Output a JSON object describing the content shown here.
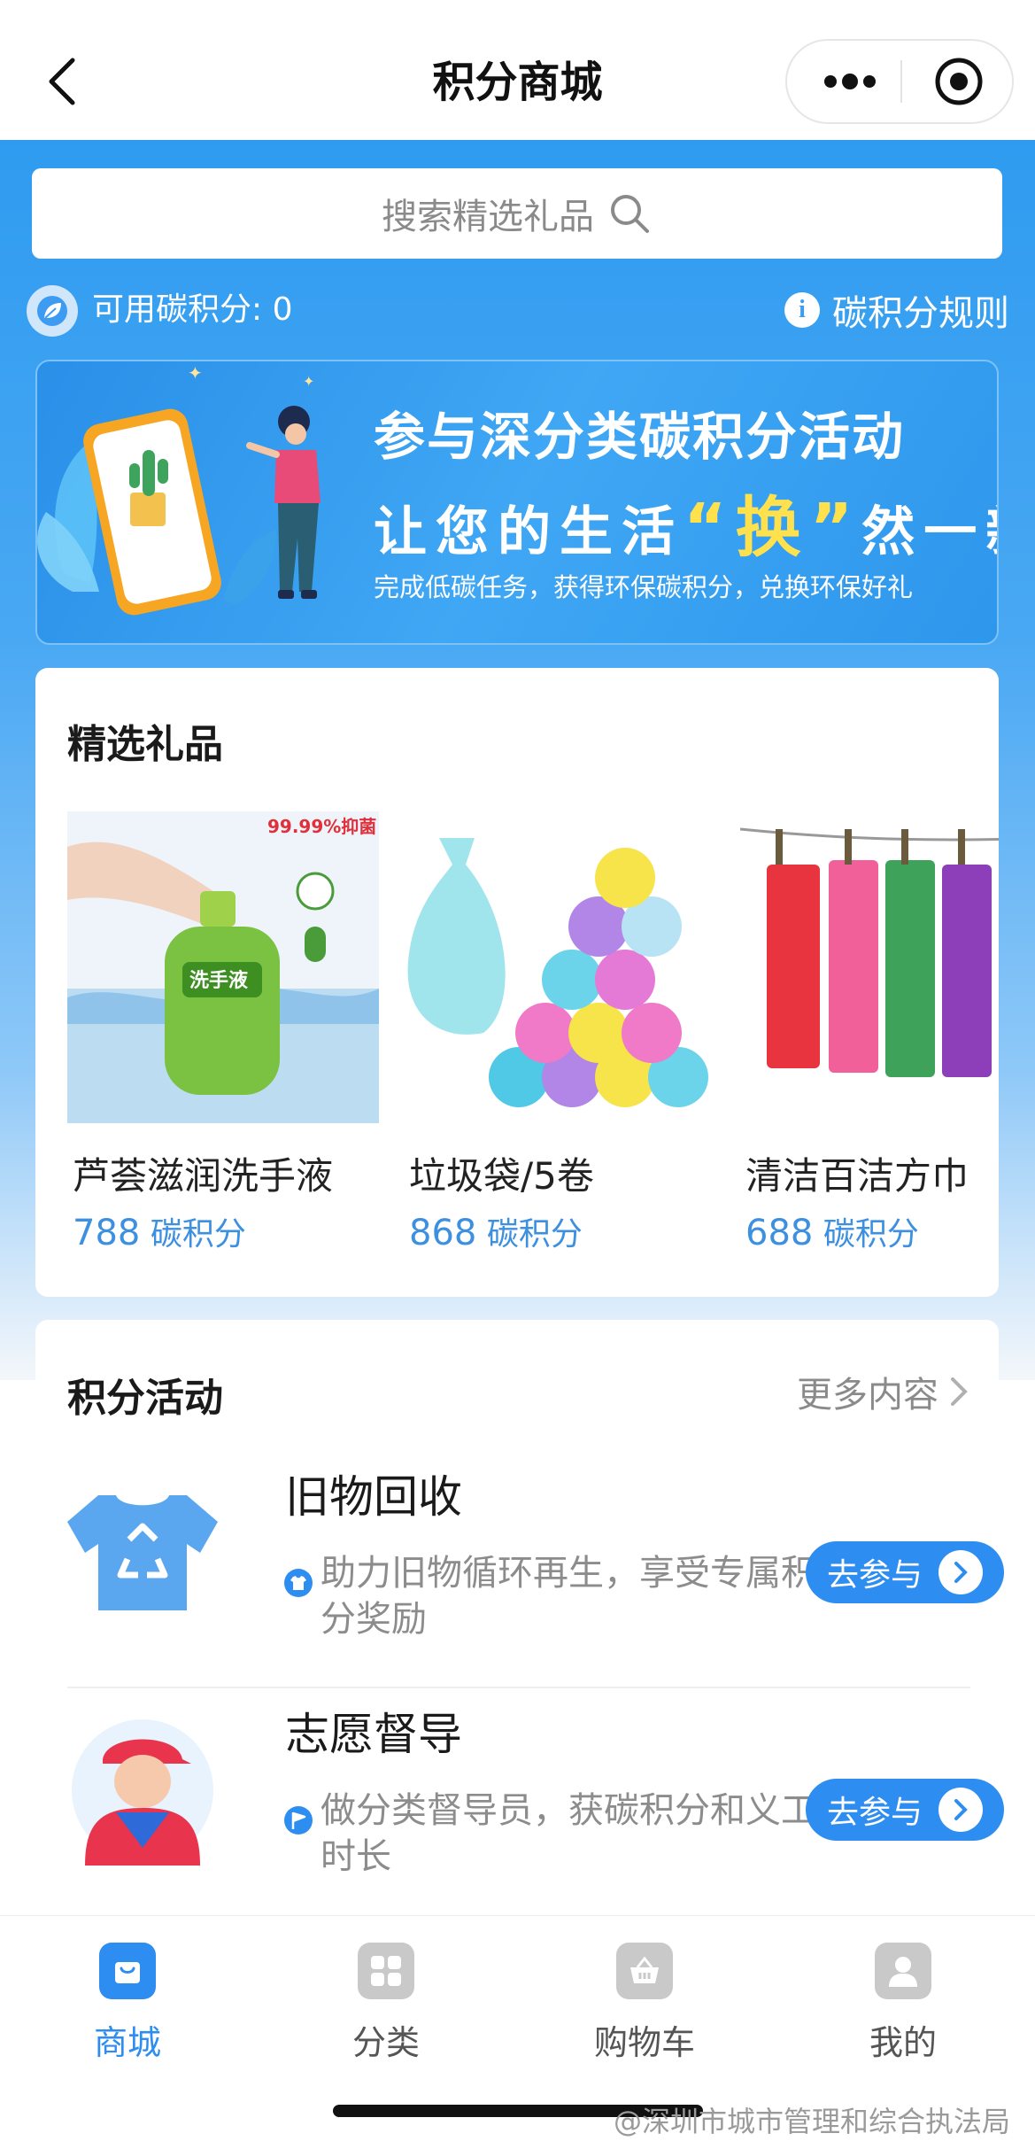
{
  "header": {
    "title": "积分商城",
    "back_icon": "chevron-left-icon",
    "more_icon": "more-dots-icon",
    "close_icon": "target-close-icon"
  },
  "search": {
    "placeholder": "搜索精选礼品"
  },
  "points": {
    "label": "可用碳积分: 0",
    "rules": "碳积分规则",
    "rules_icon_char": "i"
  },
  "banner": {
    "line1": "参与深分类碳积分活动",
    "line2_before": "让您的生活",
    "line2_highlight": "“换”",
    "line2_after": "然一新",
    "line3": "完成低碳任务，获得环保碳积分，兑换环保好礼"
  },
  "gifts": {
    "title": "精选礼品",
    "items": [
      {
        "name": "芦荟滋润洗手液",
        "price": "788",
        "unit": "碳积分",
        "img_text_1": "99.99%抑菌",
        "img_text_2": "洗手液"
      },
      {
        "name": "垃圾袋/5卷",
        "price": "868",
        "unit": "碳积分"
      },
      {
        "name": "清洁百洁方巾",
        "price": "688",
        "unit": "碳积分"
      }
    ]
  },
  "activities": {
    "title": "积分活动",
    "more": "更多内容",
    "items": [
      {
        "title": "旧物回收",
        "desc": "助力旧物循环再生，享受专属积分奖励",
        "button": "去参与"
      },
      {
        "title": "志愿督导",
        "desc": "做分类督导员，获碳积分和义工时长",
        "button": "去参与"
      }
    ]
  },
  "tabbar": {
    "items": [
      {
        "label": "商城",
        "active": true
      },
      {
        "label": "分类",
        "active": false
      },
      {
        "label": "购物车",
        "active": false
      },
      {
        "label": "我的",
        "active": false
      }
    ]
  },
  "watermark": "@深圳市城市管理和综合执法局",
  "colors": {
    "primary": "#2e8df0",
    "price": "#3d8fe0",
    "highlight": "#ffe14d",
    "inactive_tab": "#555555"
  }
}
